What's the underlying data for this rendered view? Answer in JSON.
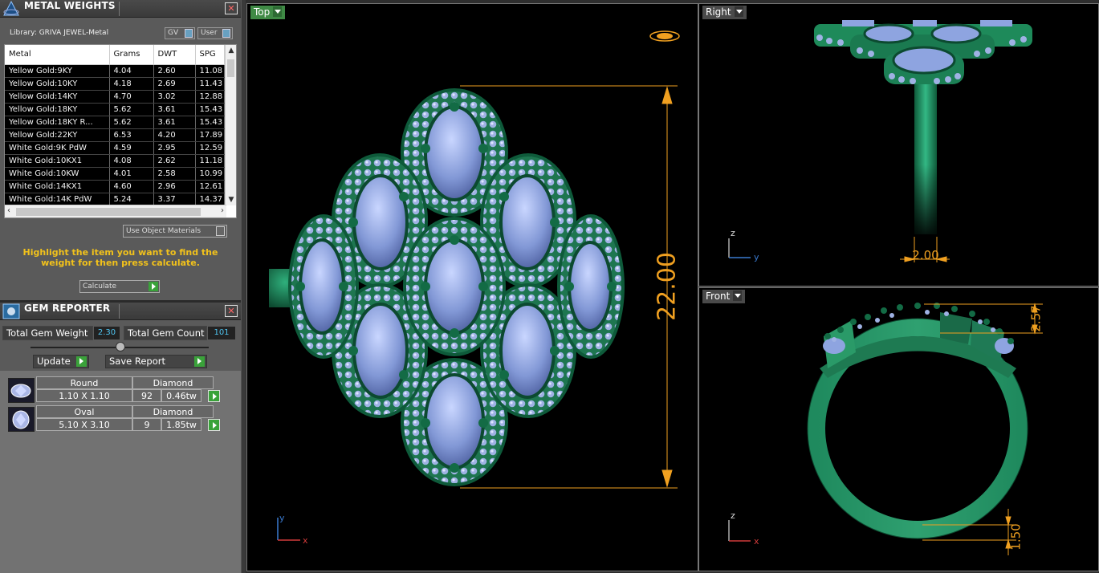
{
  "metal_weights": {
    "title": "METAL WEIGHTS",
    "library_label": "Library: GRIVA JEWEL-Metal",
    "gv_label": "GV",
    "user_label": "User",
    "columns": [
      "Metal",
      "Grams",
      "DWT",
      "SPG"
    ],
    "rows": [
      [
        "Yellow Gold:9KY",
        "4.04",
        "2.60",
        "11.08"
      ],
      [
        "Yellow Gold:10KY",
        "4.18",
        "2.69",
        "11.43"
      ],
      [
        "Yellow Gold:14KY",
        "4.70",
        "3.02",
        "12.88"
      ],
      [
        "Yellow Gold:18KY",
        "5.62",
        "3.61",
        "15.43"
      ],
      [
        "Yellow Gold:18KY R...",
        "5.62",
        "3.61",
        "15.43"
      ],
      [
        "Yellow Gold:22KY",
        "6.53",
        "4.20",
        "17.89"
      ],
      [
        "White Gold:9K PdW",
        "4.59",
        "2.95",
        "12.59"
      ],
      [
        "White Gold:10KX1",
        "4.08",
        "2.62",
        "11.18"
      ],
      [
        "White Gold:10KW",
        "4.01",
        "2.58",
        "10.99"
      ],
      [
        "White Gold:14KX1",
        "4.60",
        "2.96",
        "12.61"
      ],
      [
        "White Gold:14K PdW",
        "5.24",
        "3.37",
        "14.37"
      ]
    ],
    "use_object_materials": "Use Object Materials",
    "hint": "Highlight the item you want to find the weight for then press calculate.",
    "calculate": "Calculate"
  },
  "gem_reporter": {
    "title": "GEM REPORTER",
    "total_weight_label": "Total Gem Weight",
    "total_weight_value": "2.30",
    "total_count_label": "Total Gem Count",
    "total_count_value": "101",
    "update": "Update",
    "save_report": "Save Report",
    "gems": [
      {
        "shape": "Round",
        "material": "Diamond",
        "size": "1.10 X 1.10",
        "count": "92",
        "weight": "0.46tw"
      },
      {
        "shape": "Oval",
        "material": "Diamond",
        "size": "5.10 X 3.10",
        "count": "9",
        "weight": "1.85tw"
      }
    ]
  },
  "viewports": {
    "top": {
      "label": "Top",
      "dimension": "22.00",
      "axis_y": "y",
      "axis_x": "x"
    },
    "right": {
      "label": "Right",
      "dimension": "2.00",
      "axis_z": "z",
      "axis_y": "y"
    },
    "front": {
      "label": "Front",
      "dimension_top": "2.57",
      "dimension_bottom": "1.50",
      "axis_z": "z",
      "axis_x": "x"
    }
  },
  "colors": {
    "metal": "#1f8a5e",
    "metal_dark": "#0c4a30",
    "gem": "#8fa6e0",
    "dimension": "#f0a020",
    "viewport_tab_active": "#3f8a45",
    "viewport_tab": "#4a4a4a"
  }
}
